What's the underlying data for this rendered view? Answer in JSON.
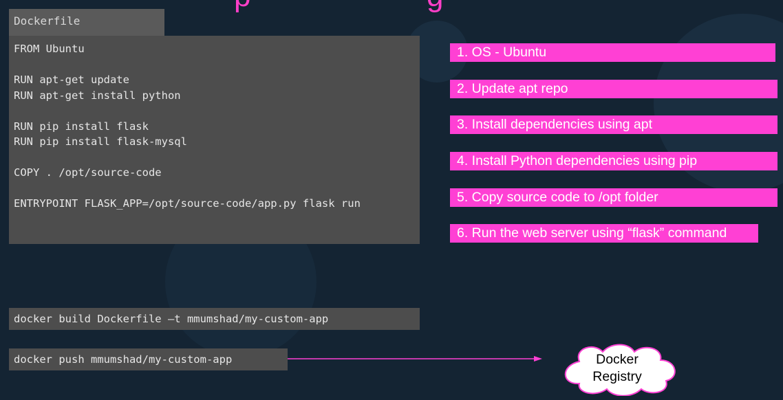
{
  "colors": {
    "background": "#142433",
    "panel": "#4d4d4d",
    "tab": "#5a5a5a",
    "accent": "#ff40d4",
    "title": "#ff3fc8"
  },
  "dockerfile": {
    "tab_label": "Dockerfile",
    "lines": [
      "FROM Ubuntu",
      "",
      "RUN apt-get update",
      "RUN apt-get install python",
      "",
      "RUN pip install flask",
      "RUN pip install flask-mysql",
      "",
      "COPY . /opt/source-code",
      "",
      "ENTRYPOINT FLASK_APP=/opt/source-code/app.py flask run"
    ]
  },
  "steps": [
    "1. OS - Ubuntu",
    "2. Update apt repo",
    "3. Install dependencies using apt",
    "4. Install Python dependencies using pip",
    "5. Copy source code to /opt folder",
    "6. Run the web server using “flask” command"
  ],
  "commands": {
    "build": "docker build Dockerfile –t mmumshad/my-custom-app",
    "push": "docker push mmumshad/my-custom-app"
  },
  "registry": {
    "line1": "Docker",
    "line2": "Registry",
    "icon": "cloud-icon"
  }
}
